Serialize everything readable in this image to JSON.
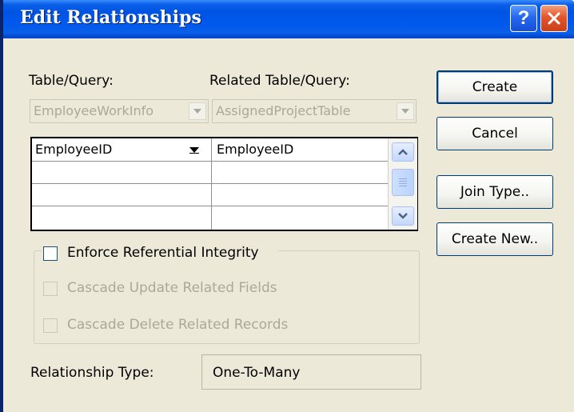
{
  "window": {
    "title": "Edit Relationships",
    "help_glyph": "?",
    "close_glyph": "✕"
  },
  "table_query": {
    "label": "Table/Query:",
    "value": "EmployeeWorkInfo"
  },
  "related_table_query": {
    "label": "Related Table/Query:",
    "value": "AssignedProjectTable"
  },
  "fields_grid": {
    "rows": [
      [
        "EmployeeID",
        "EmployeeID"
      ],
      [
        "",
        ""
      ],
      [
        "",
        ""
      ],
      [
        "",
        ""
      ]
    ]
  },
  "options": {
    "enforce_referential_integrity": {
      "label": "Enforce Referential Integrity",
      "checked": false
    },
    "cascade_update": {
      "label": "Cascade Update Related Fields",
      "checked": false,
      "enabled": false
    },
    "cascade_delete": {
      "label": "Cascade Delete Related Records",
      "checked": false,
      "enabled": false
    }
  },
  "relationship_type": {
    "label": "Relationship Type:",
    "value": "One-To-Many"
  },
  "buttons": {
    "create": "Create",
    "cancel": "Cancel",
    "join_type": "Join Type..",
    "create_new": "Create New.."
  },
  "colors": {
    "title_bar": "#0054e3",
    "dialog_face": "#ece9d8",
    "disabled_text": "#aca899",
    "close_button": "#e4552a"
  }
}
